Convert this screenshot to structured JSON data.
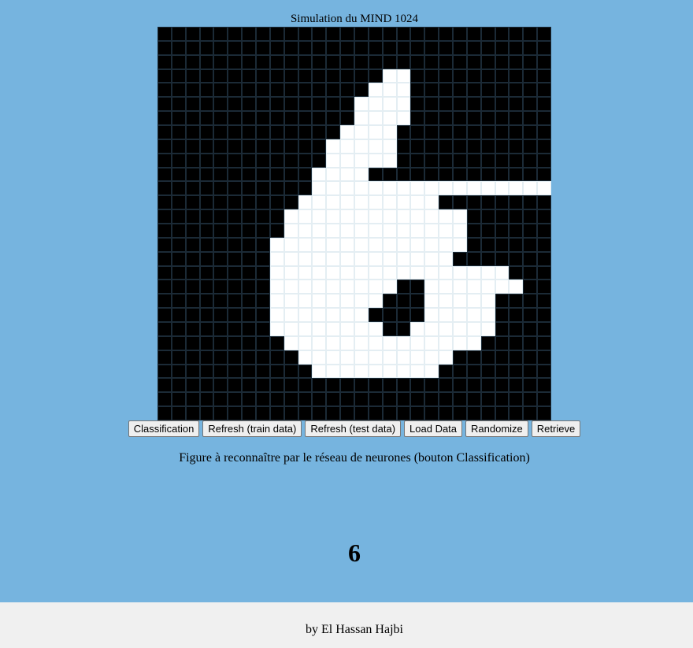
{
  "page": {
    "title": "Simulation du MIND 1024",
    "caption": "Figure à reconnaître par le réseau de neurones (bouton Classification)",
    "result": "6",
    "footer": "by El Hassan Hajbi"
  },
  "buttons": [
    {
      "label": "Classification"
    },
    {
      "label": "Refresh (train data)"
    },
    {
      "label": "Refresh (test data)"
    },
    {
      "label": "Load Data"
    },
    {
      "label": "Randomize"
    },
    {
      "label": "Retrieve"
    }
  ],
  "grid": {
    "rows": 28,
    "cols": 28,
    "pixels": [
      "............................",
      "............................",
      "..............................",
      "................**..........",
      "...............***..........",
      "..............****..........",
      "..............****..........",
      ".............****...........",
      "............*****...........",
      "............*****...........",
      "...........****.............",
      "...........*****************",
      "..........**********..........",
      ".........*************......",
      ".........*************......",
      "........**************......",
      "........*************.......",
      "........*****************...",
      "........*********..*******..",
      "........********...*****....",
      "........*******....*****....",
      "........********..******....",
      ".........**************.....",
      "..........***********.......",
      "...........*********........",
      "............................",
      "............................",
      "............................"
    ]
  }
}
